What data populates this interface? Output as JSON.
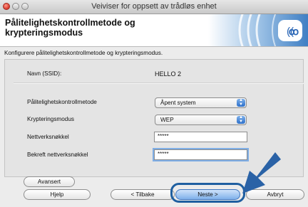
{
  "window": {
    "title": "Veiviser for oppsett av trådløs enhet"
  },
  "header": {
    "title_line1": "Pålitelighetskontrollmetode og",
    "title_line2": "krypteringsmodus"
  },
  "intro": "Konfigurere pålitelighetskontrollmetode og krypteringsmodus.",
  "ssid": {
    "label": "Navn (SSID):",
    "value": "HELLO 2"
  },
  "auth": {
    "label": "Pålitelighetskontrollmetode",
    "selected": "Åpent system"
  },
  "encryption": {
    "label": "Krypteringsmodus",
    "selected": "WEP"
  },
  "network_key": {
    "label": "Nettverksnøkkel",
    "value": "*****"
  },
  "confirm_key": {
    "label": "Bekreft nettverksnøkkel",
    "value": "*****"
  },
  "buttons": {
    "advanced": "Avansert",
    "help": "Hjelp",
    "back": "< Tilbake",
    "next": "Neste >",
    "cancel": "Avbryt"
  },
  "colors": {
    "highlight": "#1f5fa0",
    "accent_blue": "#2c6fc9"
  }
}
